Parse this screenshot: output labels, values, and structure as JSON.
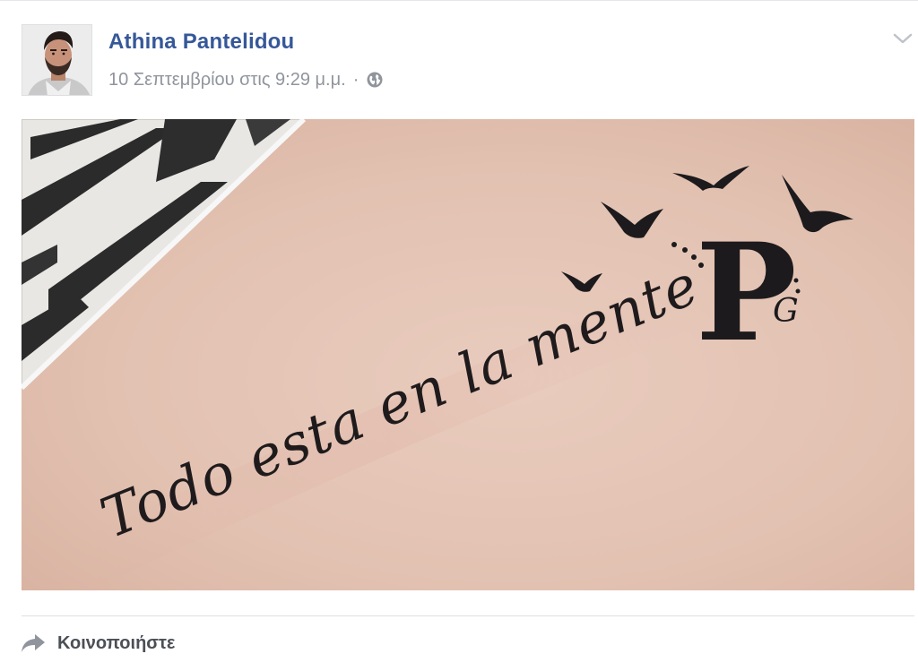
{
  "post": {
    "author": "Athina Pantelidou",
    "timestamp": "10 Σεπτεμβρίου στις 9:29 μ.μ.",
    "separator": "·",
    "privacy_icon": "globe-icon",
    "options_icon": "chevron-down-icon",
    "photo": {
      "tattoo_text": "Todo esta en la mente",
      "tattoo_monogram": "P",
      "tattoo_monogram_small": "G",
      "birds_icon": "bird-icons"
    },
    "actions": {
      "share_label": "Κοινοποιήστε",
      "share_icon": "share-arrow-icon"
    }
  },
  "colors": {
    "author_link": "#365899",
    "meta_text": "#90949c",
    "action_text": "#4b4f56",
    "divider": "#dddfe2",
    "skin": "#e3c3b4",
    "ink": "#1c1a1c"
  }
}
